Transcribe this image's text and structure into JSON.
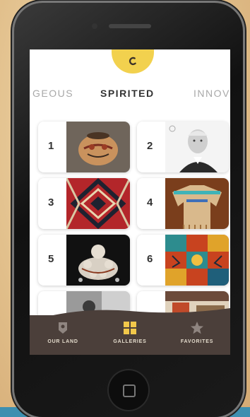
{
  "categories": {
    "prev": "GEOUS",
    "current": "SPIRITED",
    "next": "INNOV"
  },
  "top_tab": {
    "icon": "curl-icon",
    "color": "#f2d14e"
  },
  "grid": [
    {
      "num": "1",
      "label": "pottery vessel"
    },
    {
      "num": "2",
      "label": "portrait of elder"
    },
    {
      "num": "3",
      "label": "woven red rug"
    },
    {
      "num": "4",
      "label": "fringed beaded shirt"
    },
    {
      "num": "5",
      "label": "pueblo storyteller figures"
    },
    {
      "num": "6",
      "label": "colorful textile art"
    },
    {
      "num": "",
      "label": "historic photograph"
    },
    {
      "num": "",
      "label": "painted artwork"
    }
  ],
  "nav": {
    "items": [
      {
        "label": "OUR LAND",
        "icon": "map-pin-icon"
      },
      {
        "label": "GALLERIES",
        "icon": "grid-icon",
        "active": true
      },
      {
        "label": "FAVORITES",
        "icon": "star-icon"
      }
    ],
    "active_color": "#f2c84a",
    "inactive_color": "#8f8580"
  }
}
